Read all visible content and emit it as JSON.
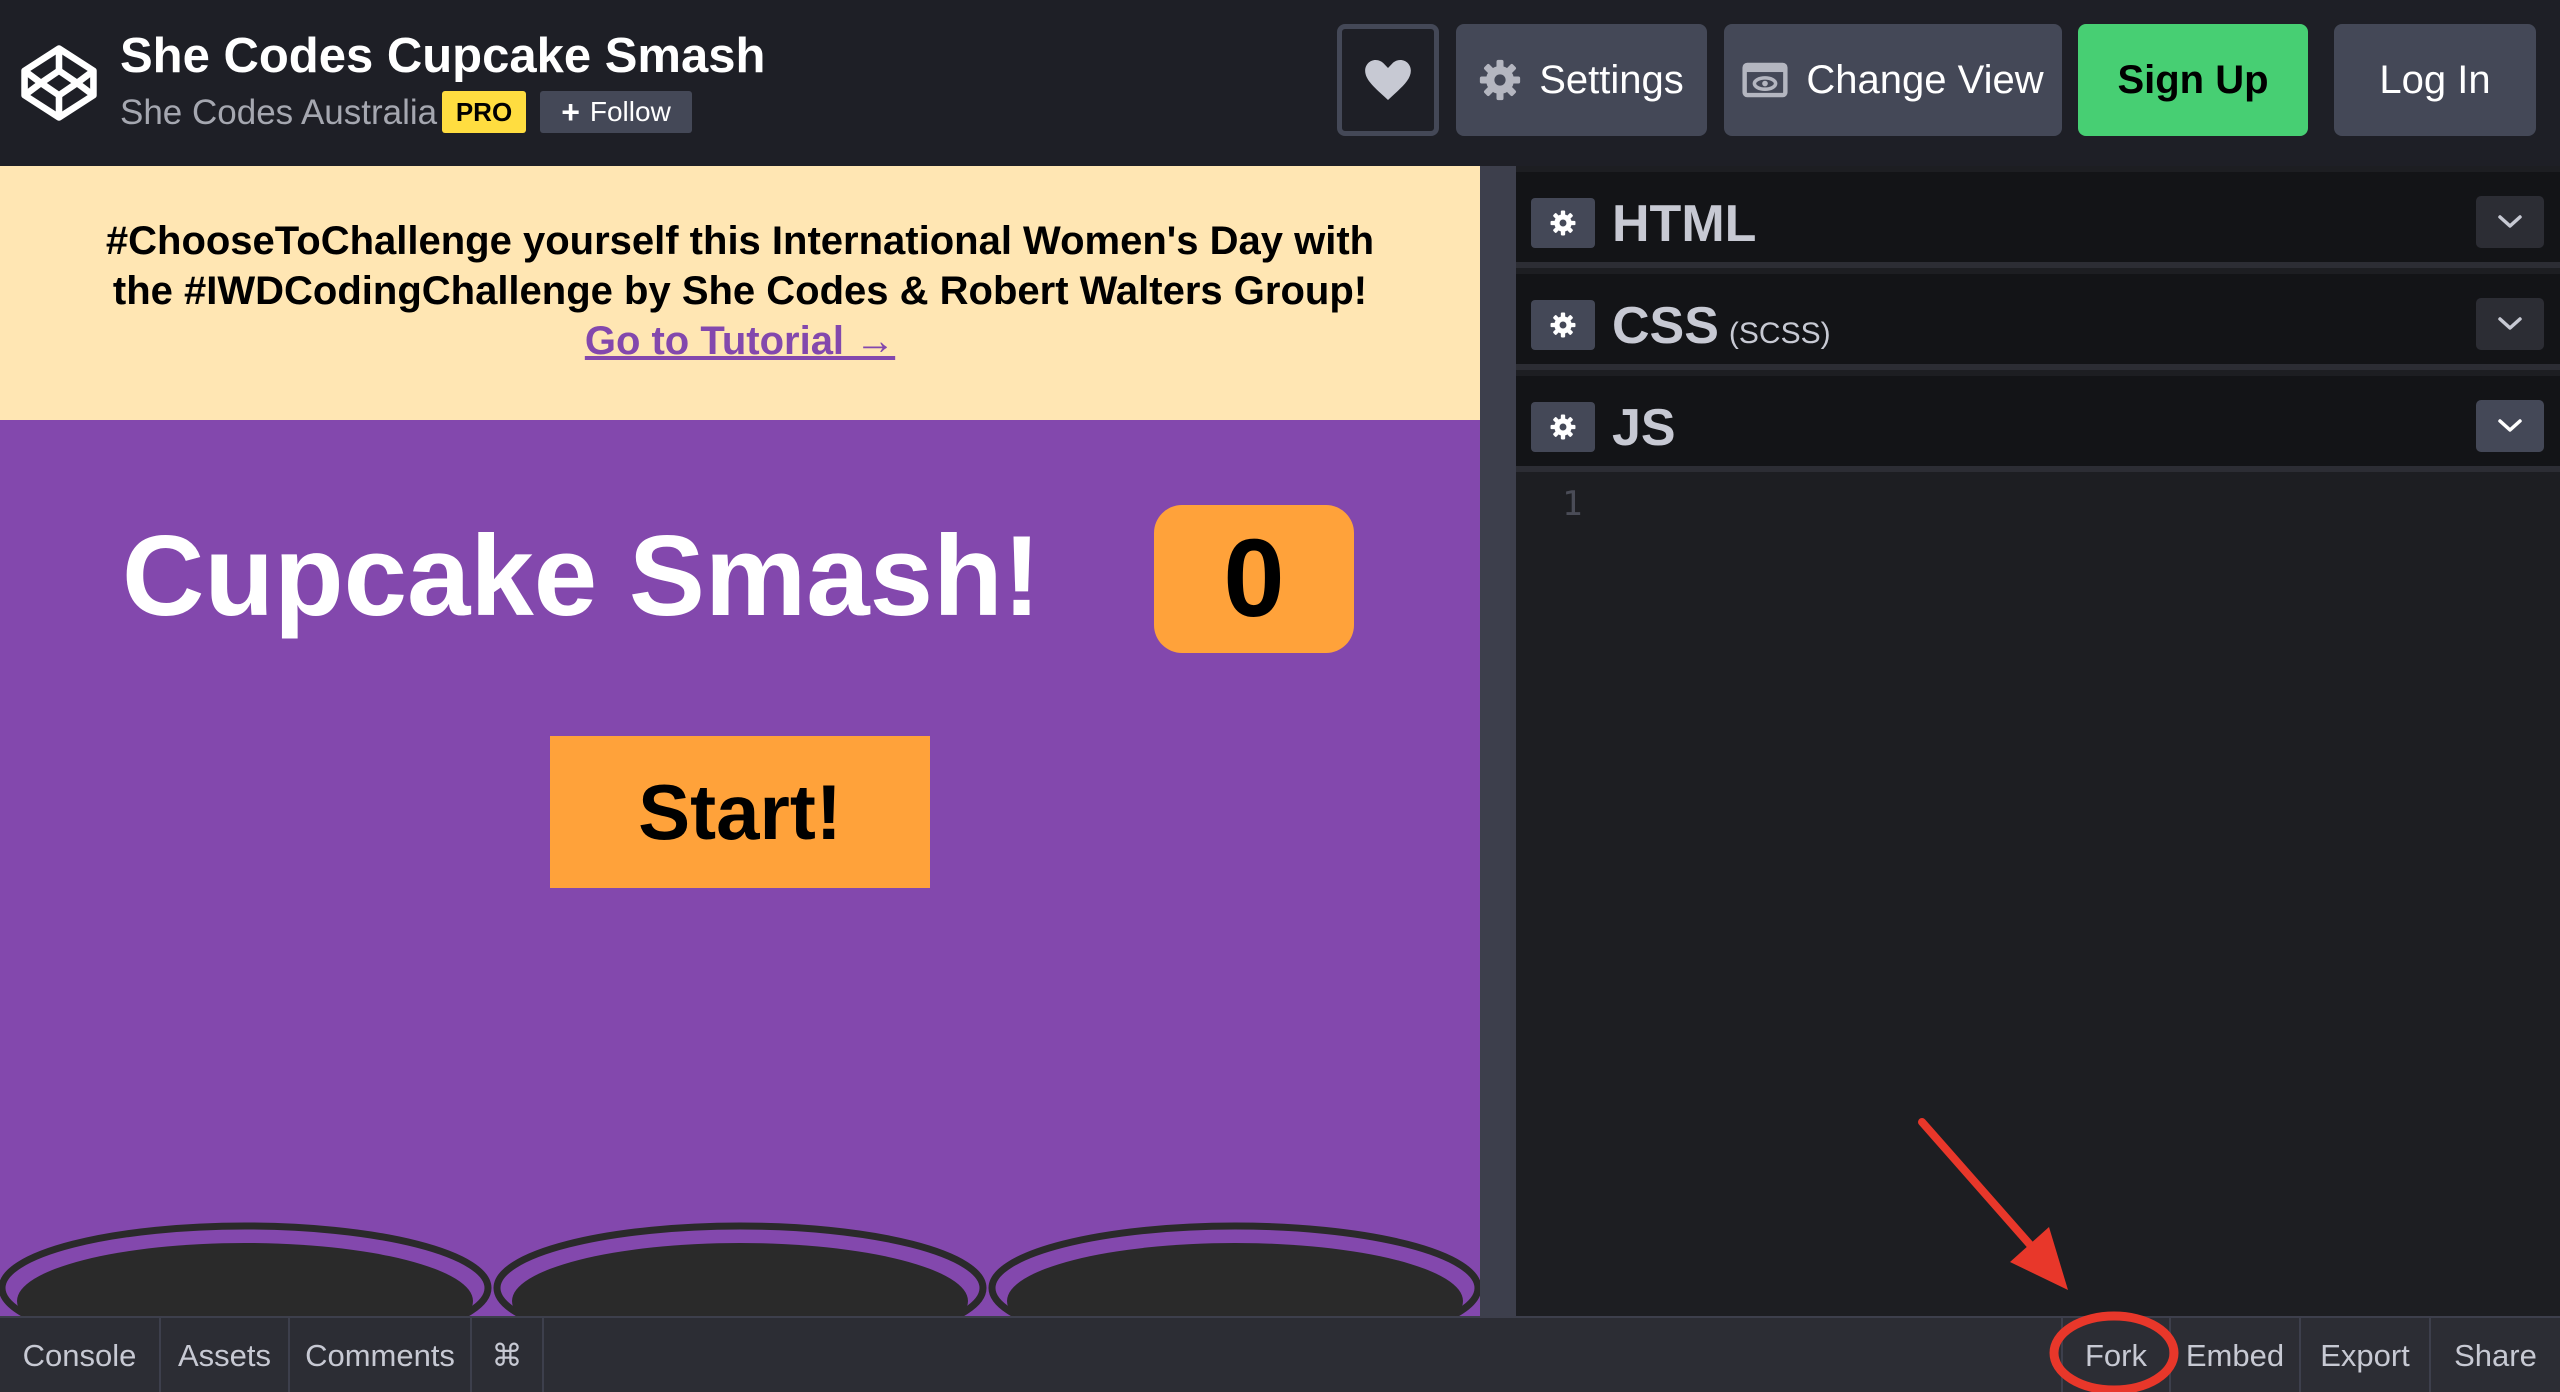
{
  "header": {
    "title": "She Codes Cupcake Smash",
    "author": "She Codes Australia",
    "pro_badge": "PRO",
    "follow_label": "Follow",
    "settings_label": "Settings",
    "change_view_label": "Change View",
    "signup_label": "Sign Up",
    "login_label": "Log In"
  },
  "banner": {
    "line1": "#ChooseToChallenge yourself this International Women's Day with",
    "line2": "the #IWDCodingChallenge by She Codes & Robert Walters Group!",
    "link": "Go to Tutorial →"
  },
  "game": {
    "title": "Cupcake Smash!",
    "score": "0",
    "start_label": "Start!"
  },
  "editor": {
    "html_label": "HTML",
    "css_label": "CSS",
    "css_sub": "(SCSS)",
    "js_label": "JS",
    "line_number": "1"
  },
  "footer": {
    "console": "Console",
    "assets": "Assets",
    "comments": "Comments",
    "shortcut": "⌘",
    "fork": "Fork",
    "embed": "Embed",
    "export": "Export",
    "share": "Share"
  },
  "colors": {
    "header_bg": "#1e1f26",
    "signup_green": "#47cf73",
    "pro_yellow": "#ffdd40",
    "preview_purple": "#8348ad",
    "banner_cream": "#ffe6b3",
    "score_orange": "#ffa23a",
    "annotation_red": "#e8372a"
  }
}
